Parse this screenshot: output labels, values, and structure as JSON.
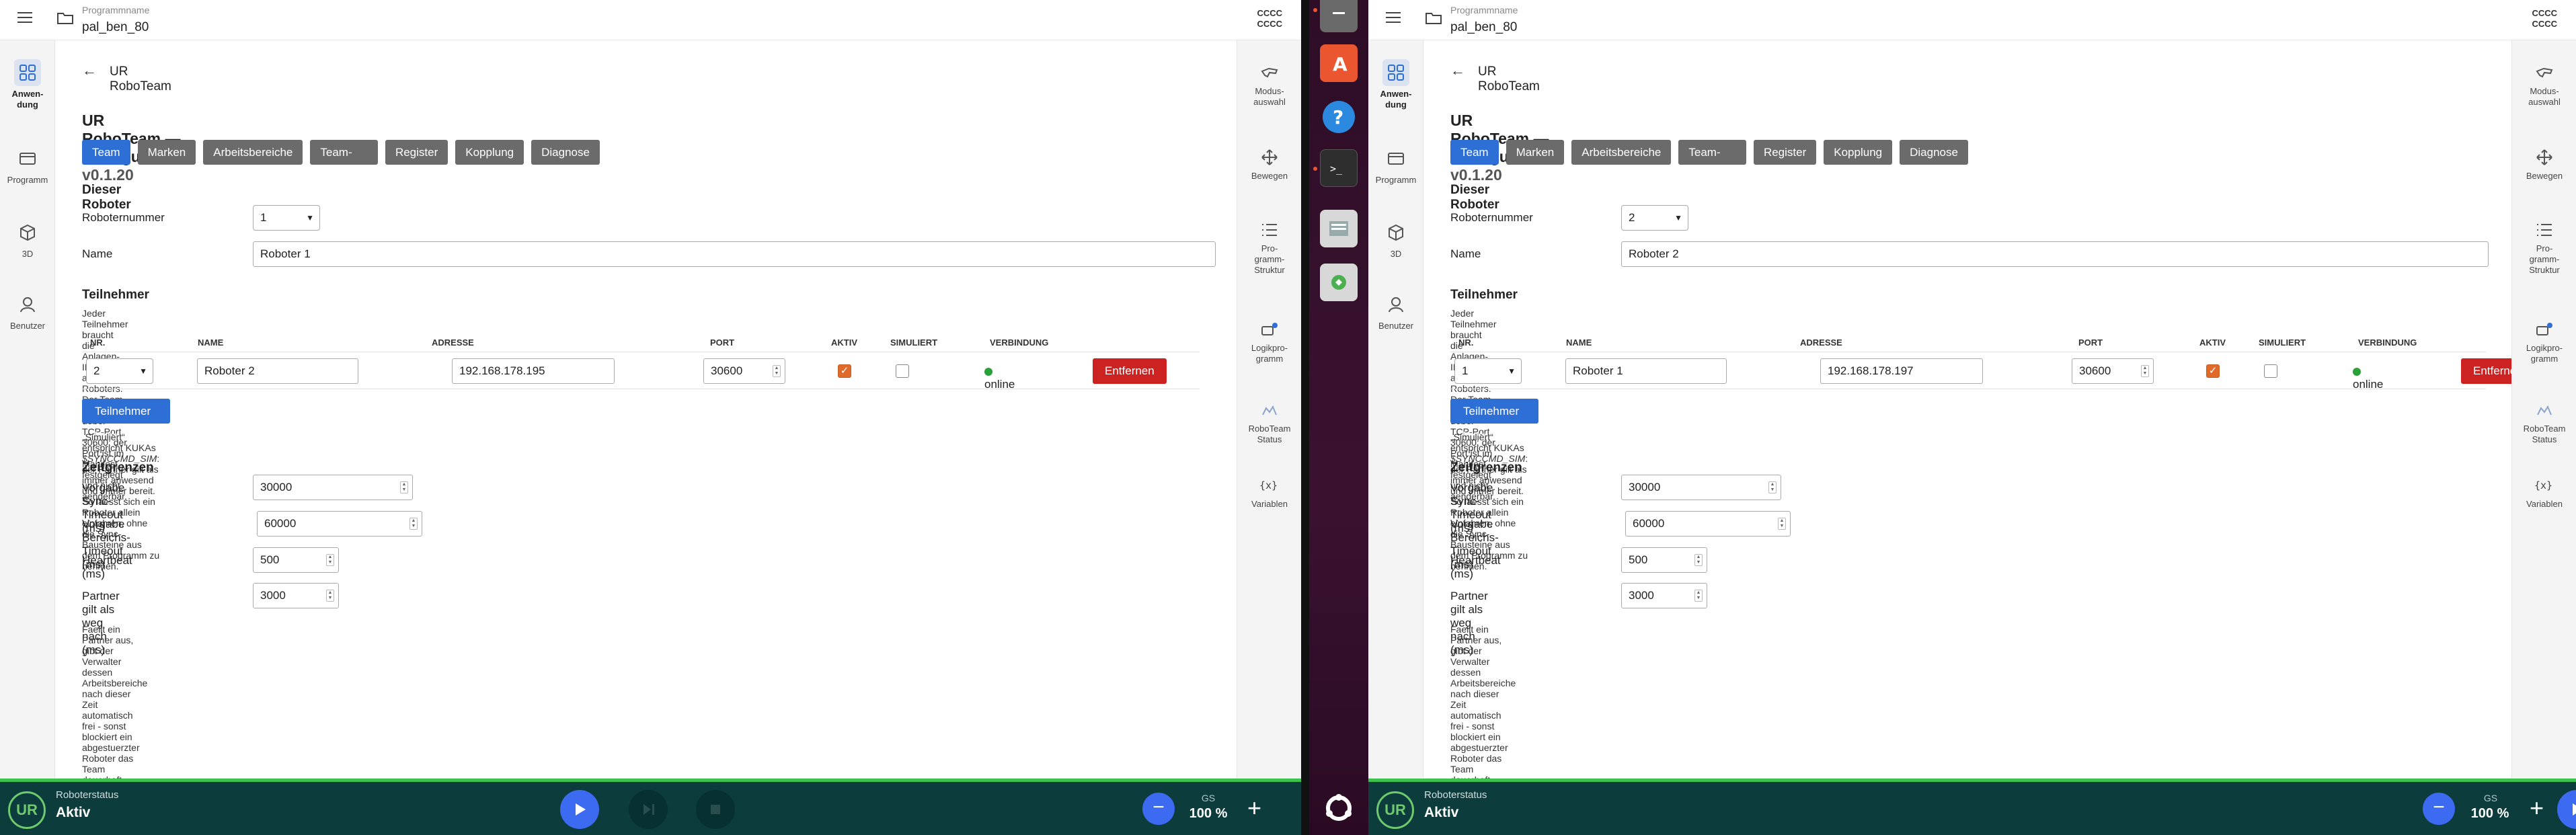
{
  "windows": [
    {
      "program_label": "Programmname",
      "program_name": "pal_ben_80",
      "corner": [
        "CCCC",
        "CCCC"
      ],
      "sidebar": [
        "Anwen-\ndung",
        "Programm",
        "3D",
        "Benutzer"
      ],
      "back_title": "UR RoboTeam",
      "title": "UR RoboTeam — Konfiguration",
      "version": "v0.1.20",
      "tabs": [
        "Team",
        "Marken",
        "Arbeitsbereiche",
        "Team-Variablen",
        "Register",
        "Kopplung",
        "Diagnose"
      ],
      "section_robot": "Dieser Roboter",
      "robot_number_label": "Roboternummer",
      "robot_number": "1",
      "name_label": "Name",
      "name_value": "Roboter 1",
      "section_participants": "Teilnehmer",
      "participants_note": "Jeder Teilnehmer braucht die Anlagen-IP des anderen Roboters. Der Team-Link laeuft ueber TCP-Port 30600; der Port ist im Manifest festgelegt und nicht aenderbar.",
      "columns": [
        "NR.",
        "NAME",
        "ADRESSE",
        "PORT",
        "AKTIV",
        "SIMULIERT",
        "VERBINDUNG"
      ],
      "row": {
        "nr": "2",
        "name": "Roboter 2",
        "address": "192.168.178.195",
        "port": "30600",
        "aktiv": true,
        "simuliert": false,
        "status": "online",
        "remove": "Entfernen"
      },
      "add_button": "Teilnehmer hinzufuegen",
      "sim_note_a": "„Simuliert“ entspricht KUKAs ",
      "sim_note_code": "$SYNCCMD_SIM",
      "sim_note_b": ": der Partner gilt als immer anwesend und immer bereit. So laesst sich ein Roboter allein einfahren, ohne die Sync-Bausteine aus dem Programm zu nehmen.",
      "section_limits": "Zeitgrenzen",
      "limits": [
        {
          "label": "Vorgabe Sync-Timeout (ms)",
          "value": "30000"
        },
        {
          "label": "Vorgabe Bereichs-Timeout (ms)",
          "value": "60000"
        },
        {
          "label": "Heartbeat (ms)",
          "value": "500"
        },
        {
          "label": "Partner gilt als weg nach (ms)",
          "value": "3000"
        }
      ],
      "limits_note": "Faellt ein Partner aus, gibt der Verwalter dessen Arbeitsbereiche nach dieser Zeit automatisch frei - sonst blockiert ein abgestuerzter Roboter das Team dauerhaft.",
      "right_bar": [
        "Modus-\nauswahl",
        "Bewegen",
        "Pro-\ngramm-\nStruktur",
        "Logikpro-\ngramm",
        "RoboTeam\nStatus",
        "Variablen"
      ],
      "status_label": "Roboterstatus",
      "status_value": "Aktiv",
      "speed_label": "GS",
      "speed_value": "100 %",
      "logo_text": "UR"
    },
    {
      "program_label": "Programmname",
      "program_name": "pal_ben_80",
      "corner": [
        "CCCC",
        "CCCC"
      ],
      "sidebar": [
        "Anwen-\ndung",
        "Programm",
        "3D",
        "Benutzer"
      ],
      "back_title": "UR RoboTeam",
      "title": "UR RoboTeam — Konfiguration",
      "version": "v0.1.20",
      "tabs": [
        "Team",
        "Marken",
        "Arbeitsbereiche",
        "Team-Variablen",
        "Register",
        "Kopplung",
        "Diagnose"
      ],
      "section_robot": "Dieser Roboter",
      "robot_number_label": "Roboternummer",
      "robot_number": "2",
      "name_label": "Name",
      "name_value": "Roboter 2",
      "section_participants": "Teilnehmer",
      "participants_note": "Jeder Teilnehmer braucht die Anlagen-IP des anderen Roboters. Der Team-Link laeuft ueber TCP-Port 30600; der Port ist im Manifest festgelegt und nicht aenderbar.",
      "columns": [
        "NR.",
        "NAME",
        "ADRESSE",
        "PORT",
        "AKTIV",
        "SIMULIERT",
        "VERBINDUNG"
      ],
      "row": {
        "nr": "1",
        "name": "Roboter 1",
        "address": "192.168.178.197",
        "port": "30600",
        "aktiv": true,
        "simuliert": false,
        "status": "online",
        "remove": "Entfernen"
      },
      "add_button": "Teilnehmer hinzufuegen",
      "sim_note_a": "„Simuliert“ entspricht KUKAs ",
      "sim_note_code": "$SYNCCMD_SIM",
      "sim_note_b": ": der Partner gilt als immer anwesend und immer bereit. So laesst sich ein Roboter allein einfahren, ohne die Sync-Bausteine aus dem Programm zu nehmen.",
      "section_limits": "Zeitgrenzen",
      "limits": [
        {
          "label": "Vorgabe Sync-Timeout (ms)",
          "value": "30000"
        },
        {
          "label": "Vorgabe Bereichs-Timeout (ms)",
          "value": "60000"
        },
        {
          "label": "Heartbeat (ms)",
          "value": "500"
        },
        {
          "label": "Partner gilt als weg nach (ms)",
          "value": "3000"
        }
      ],
      "limits_note": "Faellt ein Partner aus, gibt der Verwalter dessen Arbeitsbereiche nach dieser Zeit automatisch frei - sonst blockiert ein abgestuerzter Roboter das Team dauerhaft.",
      "right_bar": [
        "Modus-\nauswahl",
        "Bewegen",
        "Pro-\ngramm-\nStruktur",
        "Logikpro-\ngramm",
        "RoboTeam\nStatus",
        "Variablen"
      ],
      "status_label": "Roboterstatus",
      "status_value": "Aktiv",
      "speed_label": "GS",
      "speed_value": "100 %",
      "logo_text": "UR"
    }
  ],
  "colors": {
    "primary": "#2e6fd6",
    "tab": "#6b6b6b",
    "danger": "#cc2222",
    "statusbar": "#0d3c3d",
    "accent_green": "#3ec24f",
    "checkbox": "#e06a2a"
  },
  "dock_icons": [
    "files-icon",
    "app-store-icon",
    "help-icon",
    "terminal-icon",
    "disk-icon",
    "trash-icon",
    "ubuntu-icon"
  ]
}
